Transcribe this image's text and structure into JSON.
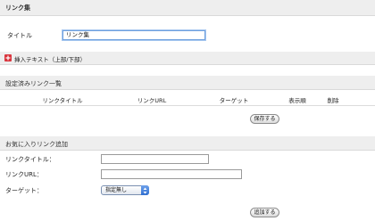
{
  "header": {
    "title": "リンク集"
  },
  "title_field": {
    "label": "タイトル",
    "value": "リンク集"
  },
  "insert_text": {
    "label": "挿入テキスト（上部/下部）",
    "icon": "plus-icon",
    "color": "#d9363e"
  },
  "configured_list": {
    "title": "設定済みリンク一覧",
    "columns": [
      "リンクタイトル",
      "リンクURL",
      "ターゲット",
      "表示順",
      "削除"
    ],
    "save_label": "保存する"
  },
  "add_favorite": {
    "title": "お気に入りリンク追加",
    "link_title_label": "リンクタイトル：",
    "link_title_value": "",
    "link_url_label": "リンクURL：",
    "link_url_value": "",
    "target_label": "ターゲット：",
    "target_selected": "指定無し",
    "add_label": "追加する"
  }
}
